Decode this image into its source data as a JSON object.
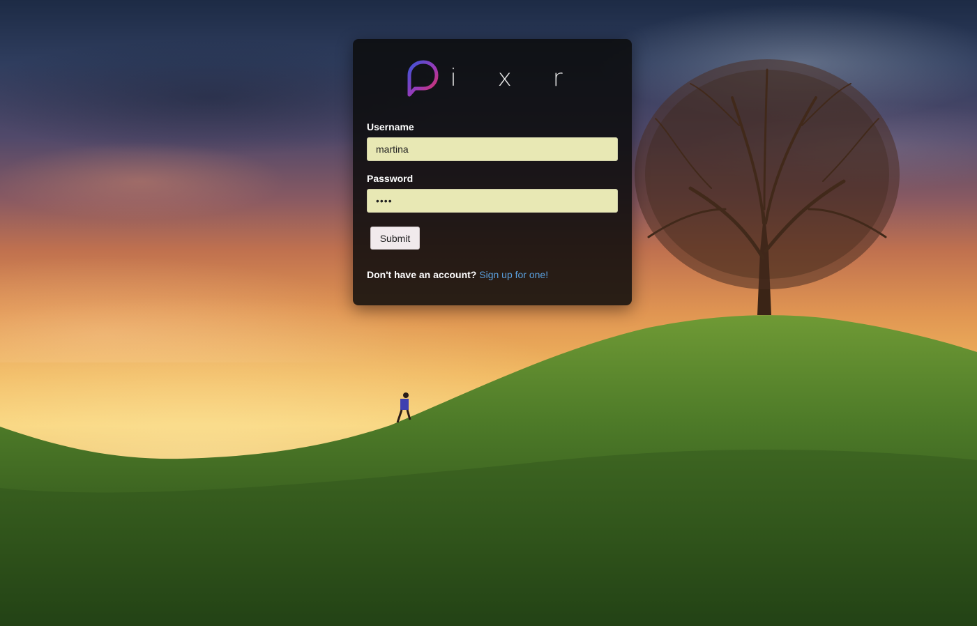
{
  "app": {
    "logo_text": "i x r",
    "logo_icon": "pixr-p-speech-bubble-icon"
  },
  "form": {
    "username_label": "Username",
    "username_value": "martina",
    "password_label": "Password",
    "password_value": "••••",
    "submit_label": "Submit"
  },
  "signup": {
    "prompt": "Don't have an account?",
    "link_label": "Sign up for one!"
  },
  "colors": {
    "card_background": "#0c0c0c",
    "input_background": "#e8e8b4",
    "link": "#5aa0de",
    "logo_gradient_start": "#3b54d8",
    "logo_gradient_end": "#e0315a"
  }
}
